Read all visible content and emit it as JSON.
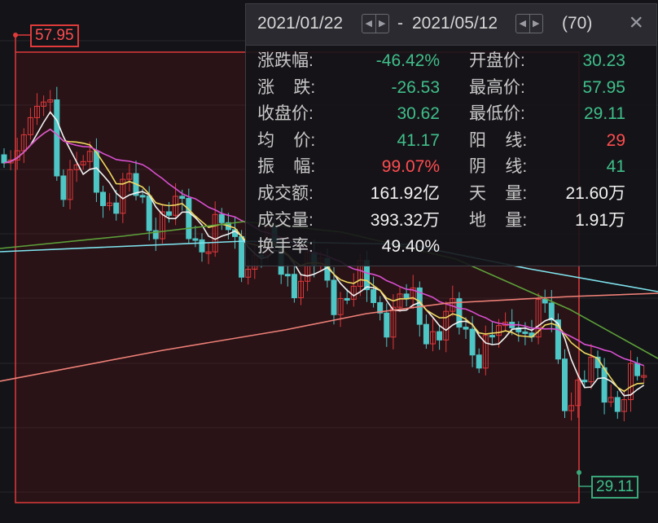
{
  "chart": {
    "high_label": "57.95",
    "low_label": "29.11",
    "colors": {
      "up": "#e0383b",
      "down": "#4ec6c6",
      "ma5": "#f2f2f2",
      "ma10": "#f0d860",
      "ma20": "#d94fd0",
      "ma60": "#5ea03a",
      "ma120": "#7fe3ee",
      "ma250": "#f08078",
      "selection_border": "#e03a3a"
    }
  },
  "panel": {
    "date_start": "2021/01/22",
    "date_sep": "-",
    "date_end": "2021/05/12",
    "count": "(70)",
    "close_icon": "×",
    "left_icon": "◀",
    "right_icon": "▶",
    "rows": [
      {
        "label1": "涨跌幅:",
        "value1": "-46.42%",
        "color1": "#3fbf8a",
        "label2": "开盘价:",
        "value2": "30.23",
        "color2": "#3fbf8a"
      },
      {
        "label1": "涨    跌:",
        "value1": "-26.53",
        "color1": "#3fbf8a",
        "label2": "最高价:",
        "value2": "57.95",
        "color2": "#3fbf8a"
      },
      {
        "label1": "收盘价:",
        "value1": "30.62",
        "color1": "#3fbf8a",
        "label2": "最低价:",
        "value2": "29.11",
        "color2": "#3fbf8a"
      },
      {
        "label1": "均    价:",
        "value1": "41.17",
        "color1": "#3fbf8a",
        "label2": "阳    线:",
        "value2": "29",
        "color2": "#ff4d4f"
      },
      {
        "label1": "振    幅:",
        "value1": "99.07%",
        "color1": "#ff4d4f",
        "label2": "阴    线:",
        "value2": "41",
        "color2": "#3fbf8a"
      },
      {
        "label1": "成交额:",
        "value1": "161.92亿",
        "color1": "#f2f2f2",
        "label2": "天    量:",
        "value2": "21.60万",
        "color2": "#f2f2f2"
      },
      {
        "label1": "成交量:",
        "value1": "393.32万",
        "color1": "#f2f2f2",
        "label2": "地    量:",
        "value2": "1.91万",
        "color2": "#f2f2f2"
      },
      {
        "label1": "换手率:",
        "value1": "49.40%",
        "color1": "#f2f2f2",
        "label2": "",
        "value2": "",
        "color2": "#f2f2f2"
      }
    ]
  }
}
